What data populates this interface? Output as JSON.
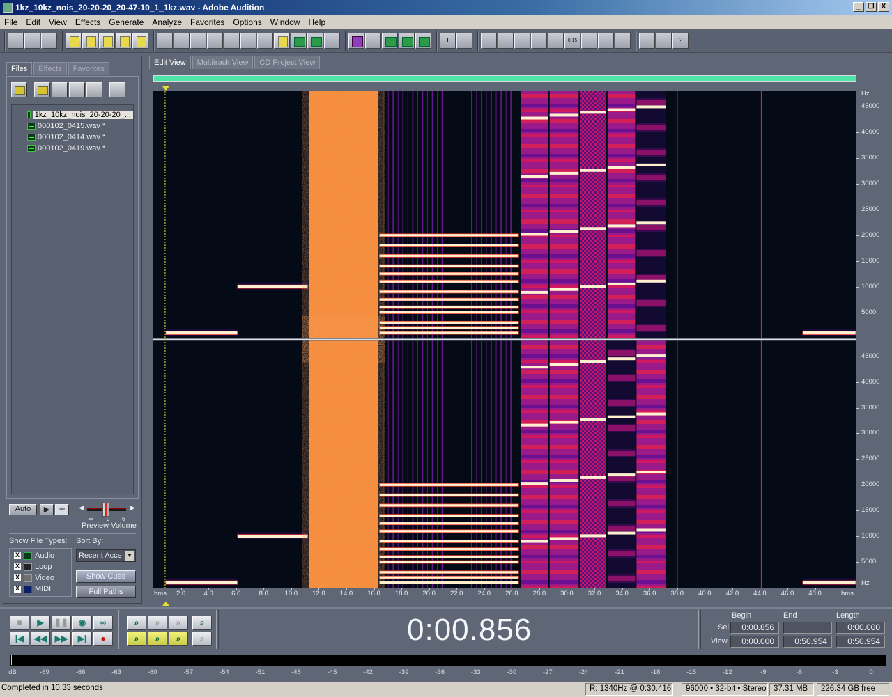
{
  "window": {
    "title": "1kz_10kz_nois_20-20-20_20-47-10_1_1kz.wav - Adobe Audition",
    "controls": [
      "_",
      "❐",
      "X"
    ]
  },
  "menu": [
    "File",
    "Edit",
    "View",
    "Effects",
    "Generate",
    "Analyze",
    "Favorites",
    "Options",
    "Window",
    "Help"
  ],
  "toolbar": {
    "groups": [
      [
        "edit-view-icon",
        "multitrack-view-icon",
        "cd-view-icon"
      ],
      [
        "new-file-icon",
        "open-file-icon",
        "save-icon",
        "save-as-icon",
        "save-all-icon"
      ],
      [
        "undo-icon",
        "redo-icon",
        "repeat-last-icon",
        "mix-paste-icon",
        "copy-icon",
        "cut-icon",
        "paste-icon",
        "copy-to-new-icon",
        "convert-sample-type-icon",
        "mark-icon",
        "zoom-selection-icon"
      ],
      [
        "spectral-view-icon",
        "waveform-icon",
        "left-channel-icon",
        "right-channel-icon",
        "both-channels-icon"
      ],
      [
        "time-selection-icon",
        "marquee-selection-icon"
      ],
      [
        "files-window-icon",
        "effects-window-icon",
        "favorites-window-icon",
        "transport-window-icon",
        "zoom-window-icon",
        "time-window-icon",
        "selection-window-icon",
        "level-meter-icon",
        "status-bar-icon"
      ],
      [
        "settings-icon",
        "script-icon",
        "help-icon"
      ]
    ]
  },
  "left_panel": {
    "tabs": [
      "Files",
      "Effects",
      "Favorites"
    ],
    "active_tab": "Files",
    "file_buttons": [
      "open-file-icon",
      "close-file-icon",
      "insert-multitrack-icon",
      "insert-cd-icon",
      "edit-file-icon",
      "auto-play-options-icon"
    ],
    "files": [
      {
        "name": "1kz_10kz_nois_20-20-20_...",
        "selected": true
      },
      {
        "name": "000102_0415.wav *",
        "selected": false
      },
      {
        "name": "000102_0414.wav *",
        "selected": false
      },
      {
        "name": "000102_0419.wav *",
        "selected": false
      }
    ],
    "preview": {
      "auto_label": "Auto",
      "play_label": "▶",
      "loop_label": "∞",
      "volume_min": "-∞",
      "volume_mid": "0",
      "volume_max": "6",
      "volume_label": "Preview Volume",
      "volume_level_db": 0
    },
    "show_file_types_label": "Show File Types:",
    "file_types": [
      {
        "label": "Audio",
        "checked": true,
        "color": "#2db34a"
      },
      {
        "label": "Loop",
        "checked": true,
        "color": "#222222"
      },
      {
        "label": "Video",
        "checked": true,
        "color": "#707070"
      },
      {
        "label": "MIDI",
        "checked": true,
        "color": "#1a4fbf"
      }
    ],
    "sort_by_label": "Sort By:",
    "sort_by_value": "Recent Acce",
    "show_cues_label": "Show Cues",
    "full_paths_label": "Full Paths"
  },
  "main": {
    "tabs": [
      "Edit View",
      "Multitrack View",
      "CD Project View"
    ],
    "active_tab": "Edit View",
    "freq_axis": {
      "unit": "Hz",
      "ticks": [
        "45000",
        "40000",
        "35000",
        "30000",
        "25000",
        "20000",
        "15000",
        "10000",
        "5000"
      ],
      "max_hz": 48000
    },
    "time_axis": {
      "unit": "hms",
      "ticks": [
        "2.0",
        "4.0",
        "6.0",
        "8.0",
        "10.0",
        "12.0",
        "14.0",
        "16.0",
        "18.0",
        "20.0",
        "22.0",
        "24.0",
        "26.0",
        "28.0",
        "30.0",
        "32.0",
        "34.0",
        "36.0",
        "38.0",
        "40.0",
        "42.0",
        "44.0",
        "46.0",
        "48.0"
      ],
      "total_seconds": 50.954
    },
    "cursor_seconds": 0.856,
    "colors": {
      "background": "#040a16",
      "noise": "#f48a3a",
      "tone": "#fff0d0",
      "band": "#c2188a",
      "overview": "#4ee6a8"
    },
    "segments": [
      {
        "type": "tone",
        "start": 0.9,
        "end": 6.1,
        "freq_hz": [
          1000
        ]
      },
      {
        "type": "tone",
        "start": 6.1,
        "end": 11.2,
        "freq_hz": [
          10000
        ]
      },
      {
        "type": "noise",
        "start": 11.3,
        "end": 16.3
      },
      {
        "type": "multitone",
        "start": 16.3,
        "end": 26.6,
        "freq_hz": [
          1000,
          2000,
          3000,
          5000,
          6000,
          7500,
          9000,
          11000,
          12500,
          14000,
          16000,
          18000,
          20000
        ]
      },
      {
        "type": "sweep-band",
        "start": 26.6,
        "end": 28.7
      },
      {
        "type": "sweep-band",
        "start": 28.7,
        "end": 30.9
      },
      {
        "type": "checker-band",
        "start": 30.9,
        "end": 32.9
      },
      {
        "type": "sweep-band",
        "start": 32.9,
        "end": 35.0
      },
      {
        "type": "harmonic-band",
        "start": 35.0,
        "end": 37.2
      },
      {
        "type": "impulse",
        "start": 38.0
      },
      {
        "type": "impulse",
        "start": 44.1
      },
      {
        "type": "tone",
        "start": 47.1,
        "end": 50.954,
        "freq_hz": [
          1000
        ]
      }
    ]
  },
  "transport": {
    "buttons": [
      "stop-icon",
      "play-icon",
      "pause-icon",
      "play-to-end-icon",
      "loop-icon",
      "go-to-start-icon",
      "rewind-icon",
      "fast-forward-icon",
      "go-to-end-icon",
      "record-icon"
    ],
    "zoom_buttons": [
      "zoom-in-horizontal-icon",
      "zoom-out-horizontal-icon",
      "zoom-full-icon",
      "zoom-in-vertical-icon",
      "zoom-to-left-icon",
      "zoom-to-selection-icon",
      "zoom-to-right-icon",
      "zoom-out-vertical-icon"
    ],
    "time_display": "0:00.856"
  },
  "selection": {
    "headers": [
      "Begin",
      "End",
      "Length"
    ],
    "sel_label": "Sel",
    "view_label": "View",
    "sel": {
      "begin": "0:00.856",
      "end": "",
      "length": "0:00.000"
    },
    "view": {
      "begin": "0:00.000",
      "end": "0:50.954",
      "length": "0:50.954"
    }
  },
  "level_meter": {
    "unit": "dB",
    "ticks": [
      "-69",
      "-66",
      "-63",
      "-60",
      "-57",
      "-54",
      "-51",
      "-48",
      "-45",
      "-42",
      "-39",
      "-36",
      "-33",
      "-30",
      "-27",
      "-24",
      "-21",
      "-18",
      "-15",
      "-12",
      "-9",
      "-6",
      "-3",
      "0"
    ]
  },
  "status_bar": {
    "message": "Completed in 10.33 seconds",
    "readout": "R: 1340Hz @   0:30.416",
    "format": "96000 • 32-bit • Stereo",
    "size": "37.31 MB",
    "free": "226.34 GB free"
  }
}
